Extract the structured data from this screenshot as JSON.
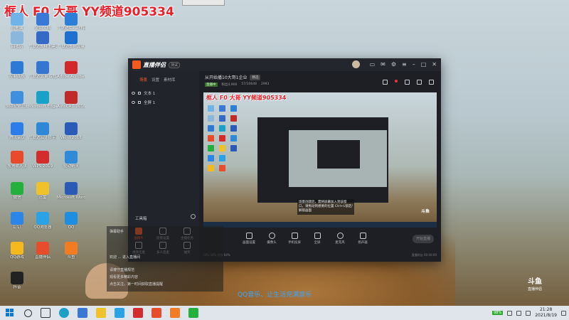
{
  "overlay": {
    "title": "框人 F0 大哥 YY频道905334"
  },
  "desktop_icons": [
    {
      "label": "此电脑",
      "color": "#6fb4e8"
    },
    {
      "label": "金山文档",
      "color": "#3a78d8"
    },
    {
      "label": "广联达G+工作台",
      "color": "#2b7fd9"
    },
    {
      "label": "回收站",
      "color": "#8bb7dc"
    },
    {
      "label": "广联达BIM土建计量平台",
      "color": "#3569c7"
    },
    {
      "label": "广联达BIM算量",
      "color": "#1d6fd0"
    },
    {
      "label": "控制面板",
      "color": "#2a7ad6"
    },
    {
      "label": "广联达算量 GTJ2021",
      "color": "#3575d2"
    },
    {
      "label": "Adobe Acrobat DC",
      "color": "#d3272b"
    },
    {
      "label": "360安全卫士",
      "color": "#3d8fe0"
    },
    {
      "label": "Microsoft Edge",
      "color": "#1aa1c7"
    },
    {
      "label": "AutoCAD 2016",
      "color": "#c22a2a"
    },
    {
      "label": "腾讯会议",
      "color": "#2b7de9"
    },
    {
      "label": "广联达云计价平台",
      "color": "#2f87d8"
    },
    {
      "label": "Word 2016",
      "color": "#2a5bb8"
    },
    {
      "label": "搜狗输入法",
      "color": "#e84a2a"
    },
    {
      "label": "WPS 2019",
      "color": "#d42c2c"
    },
    {
      "label": "驱动精灵",
      "color": "#2f8ad8"
    },
    {
      "label": "微信",
      "color": "#23b13c"
    },
    {
      "label": "迅雷",
      "color": "#f0c22a"
    },
    {
      "label": "Microsoft Word",
      "color": "#2b59b6"
    },
    {
      "label": "钉钉",
      "color": "#2a86e8"
    },
    {
      "label": "QQ浏览器",
      "color": "#29a2e6"
    },
    {
      "label": "QQ",
      "color": "#1d8ee0"
    },
    {
      "label": "QQ游戏",
      "color": "#f5b81d"
    },
    {
      "label": "直播伴侣",
      "color": "#e94b2d"
    },
    {
      "label": "斗鱼",
      "color": "#f37b22"
    },
    {
      "label": "抖音",
      "color": "#222222"
    }
  ],
  "app": {
    "logo": "直播伴侣",
    "version": "测试",
    "tabs": [
      "场景",
      "设置",
      "素材库"
    ],
    "sources": [
      {
        "label": "文本 1"
      },
      {
        "label": "全屏 1"
      }
    ],
    "tools_header": "工具箱",
    "tools": [
      {
        "label": "插播片",
        "active": true
      },
      {
        "label": "房管设置",
        "active": false
      },
      {
        "label": "主播任务",
        "active": false
      },
      {
        "label": "视频连麦",
        "active": false
      },
      {
        "label": "多人连麦",
        "active": false
      },
      {
        "label": "抽奖",
        "active": false
      },
      {
        "label": "虚拟形象",
        "active": false
      },
      {
        "label": "话题",
        "active": false
      },
      {
        "label": "数据面板",
        "active": false
      }
    ],
    "room": {
      "title": "从开始播10大哥1企业",
      "tag": "精选",
      "status": "直播中",
      "sub1": "粉丝4,906",
      "sub2": "57/10648",
      "sub3": "2993"
    },
    "preview": {
      "title": "框人 F0 大哥 YY频道905334",
      "tooltip": "场景创建后，需将屏幕加入到该窗口，请拖动到想要的位置 Ctrl+L锁定/解锁画面"
    },
    "bottom_controls": [
      "画面设置",
      "摄像头",
      "手机投屏",
      "全屏",
      "麦克风",
      "扬声器"
    ],
    "start_live": "开始直播",
    "status_left": "CPU 30%  内存 64%",
    "status_right": "直播时长 00:00:00"
  },
  "chat": {
    "lines": [
      "弹幕助手",
      "欢迎 ... 进入直播间",
      "请遵守直播规范",
      "观看更多精彩内容",
      "点击关注，第一时间获取直播提醒"
    ]
  },
  "caption": "QQ音乐、让生活充满音乐",
  "douyu": {
    "name": "斗鱼",
    "sub": "直播伴侣"
  },
  "taskbar": {
    "battery": "98%",
    "time": "21:28",
    "date": "2021/8/19"
  }
}
